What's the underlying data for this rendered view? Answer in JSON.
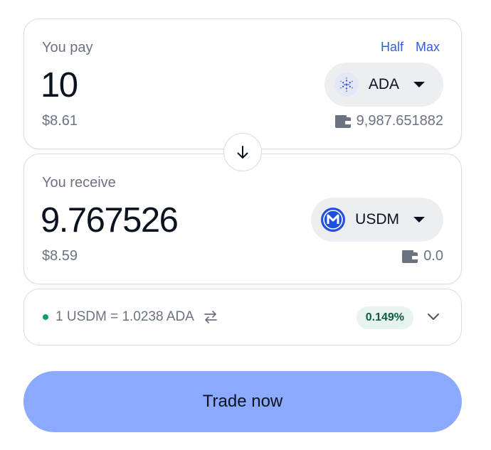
{
  "pay": {
    "label": "You pay",
    "half_label": "Half",
    "max_label": "Max",
    "amount": "10",
    "usd_value": "$8.61",
    "token": {
      "symbol": "ADA",
      "icon": "cardano-icon",
      "icon_color": "#3b5bdb"
    },
    "balance": "9,987.651882"
  },
  "receive": {
    "label": "You receive",
    "amount": "9.767526",
    "usd_value": "$8.59",
    "token": {
      "symbol": "USDM",
      "icon": "usdm-icon",
      "icon_color": "#1f4fe0"
    },
    "balance": "0.0"
  },
  "rate": {
    "text": "1 USDM = 1.0238 ADA",
    "impact_badge": "0.149%",
    "status_color": "#0f9d6e"
  },
  "action": {
    "trade_label": "Trade now",
    "button_color": "#8aa9ff"
  },
  "icons": {
    "swap": "arrow-down-icon",
    "wallet": "wallet-icon",
    "toggle_rate": "swap-horizontal-icon",
    "expand": "chevron-down-icon"
  }
}
